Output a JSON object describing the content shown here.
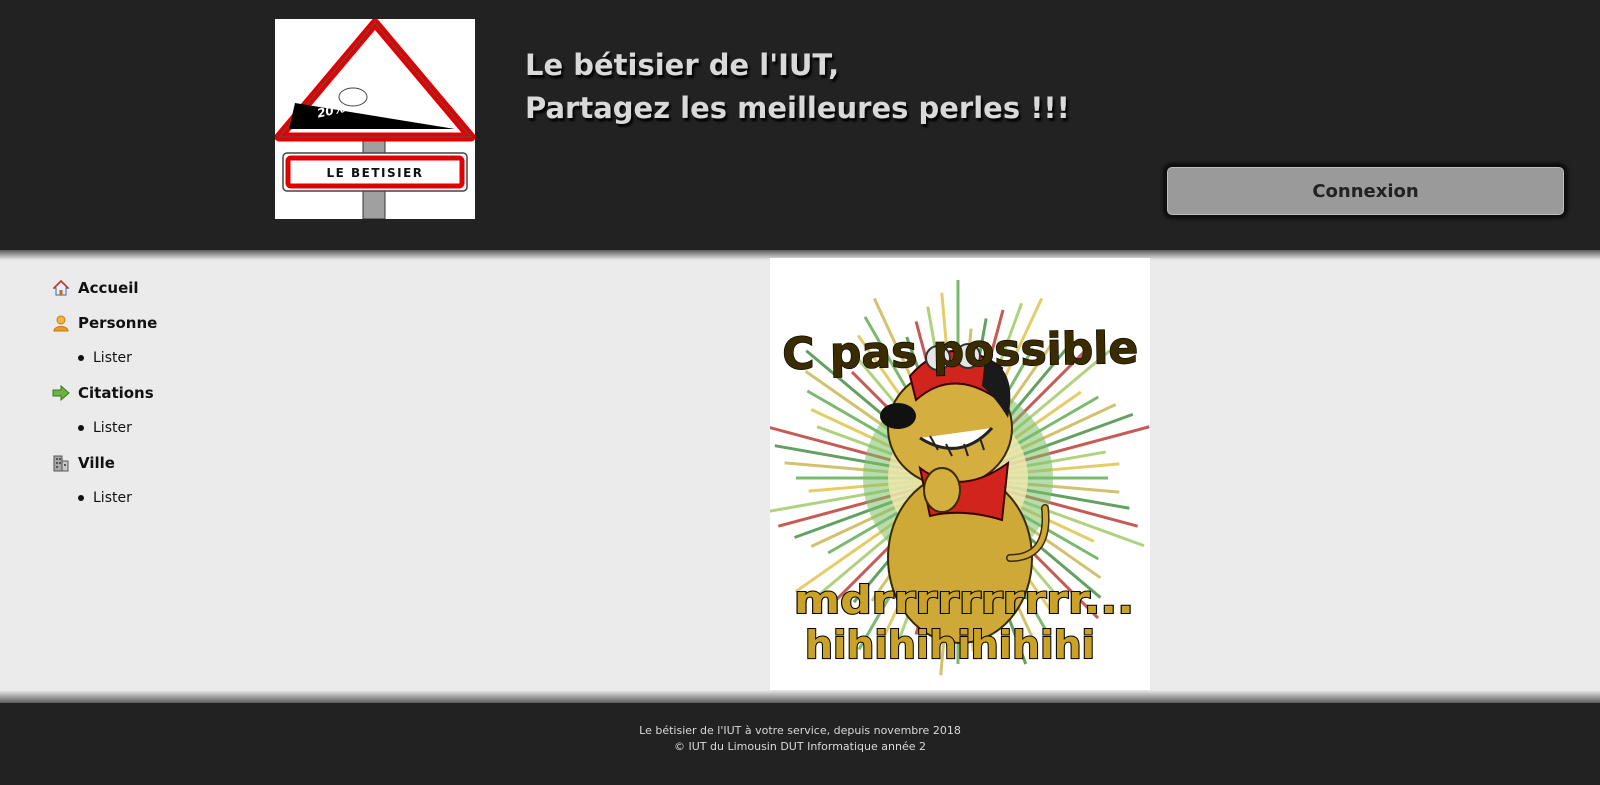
{
  "header": {
    "logo": {
      "alt": "Le bétisier logo",
      "sign_percent": "20%",
      "sign_label": "LE BETISIER"
    },
    "tagline_line1": "Le bétisier de l'IUT,",
    "tagline_line2": "Partagez les meilleures perles !!!",
    "login_button": "Connexion"
  },
  "menu": [
    {
      "label": "Accueil",
      "icon": "home-icon"
    },
    {
      "label": "Personne",
      "icon": "person-icon",
      "items": [
        "Lister"
      ]
    },
    {
      "label": "Citations",
      "icon": "arrow-right-icon",
      "items": [
        "Lister"
      ]
    },
    {
      "label": "Ville",
      "icon": "building-icon",
      "items": [
        "Lister"
      ]
    }
  ],
  "main": {
    "image": {
      "alt": "C pas possible mdrrrrrrrrrr... hihihihihihihi",
      "caption_top": "C pas possible",
      "caption_mid": "mdrrrrrrrrrr...",
      "caption_bottom": "hihihihihihihi"
    }
  },
  "footer": {
    "line1": "Le bétisier de l'IUT à votre service, depuis novembre 2018",
    "line2": "© IUT du Limousin DUT Informatique année 2"
  },
  "colors": {
    "header_bg": "#222222",
    "page_bg": "#ebebeb",
    "button_bg": "#9a9a9a",
    "sign_red": "#e00000"
  }
}
